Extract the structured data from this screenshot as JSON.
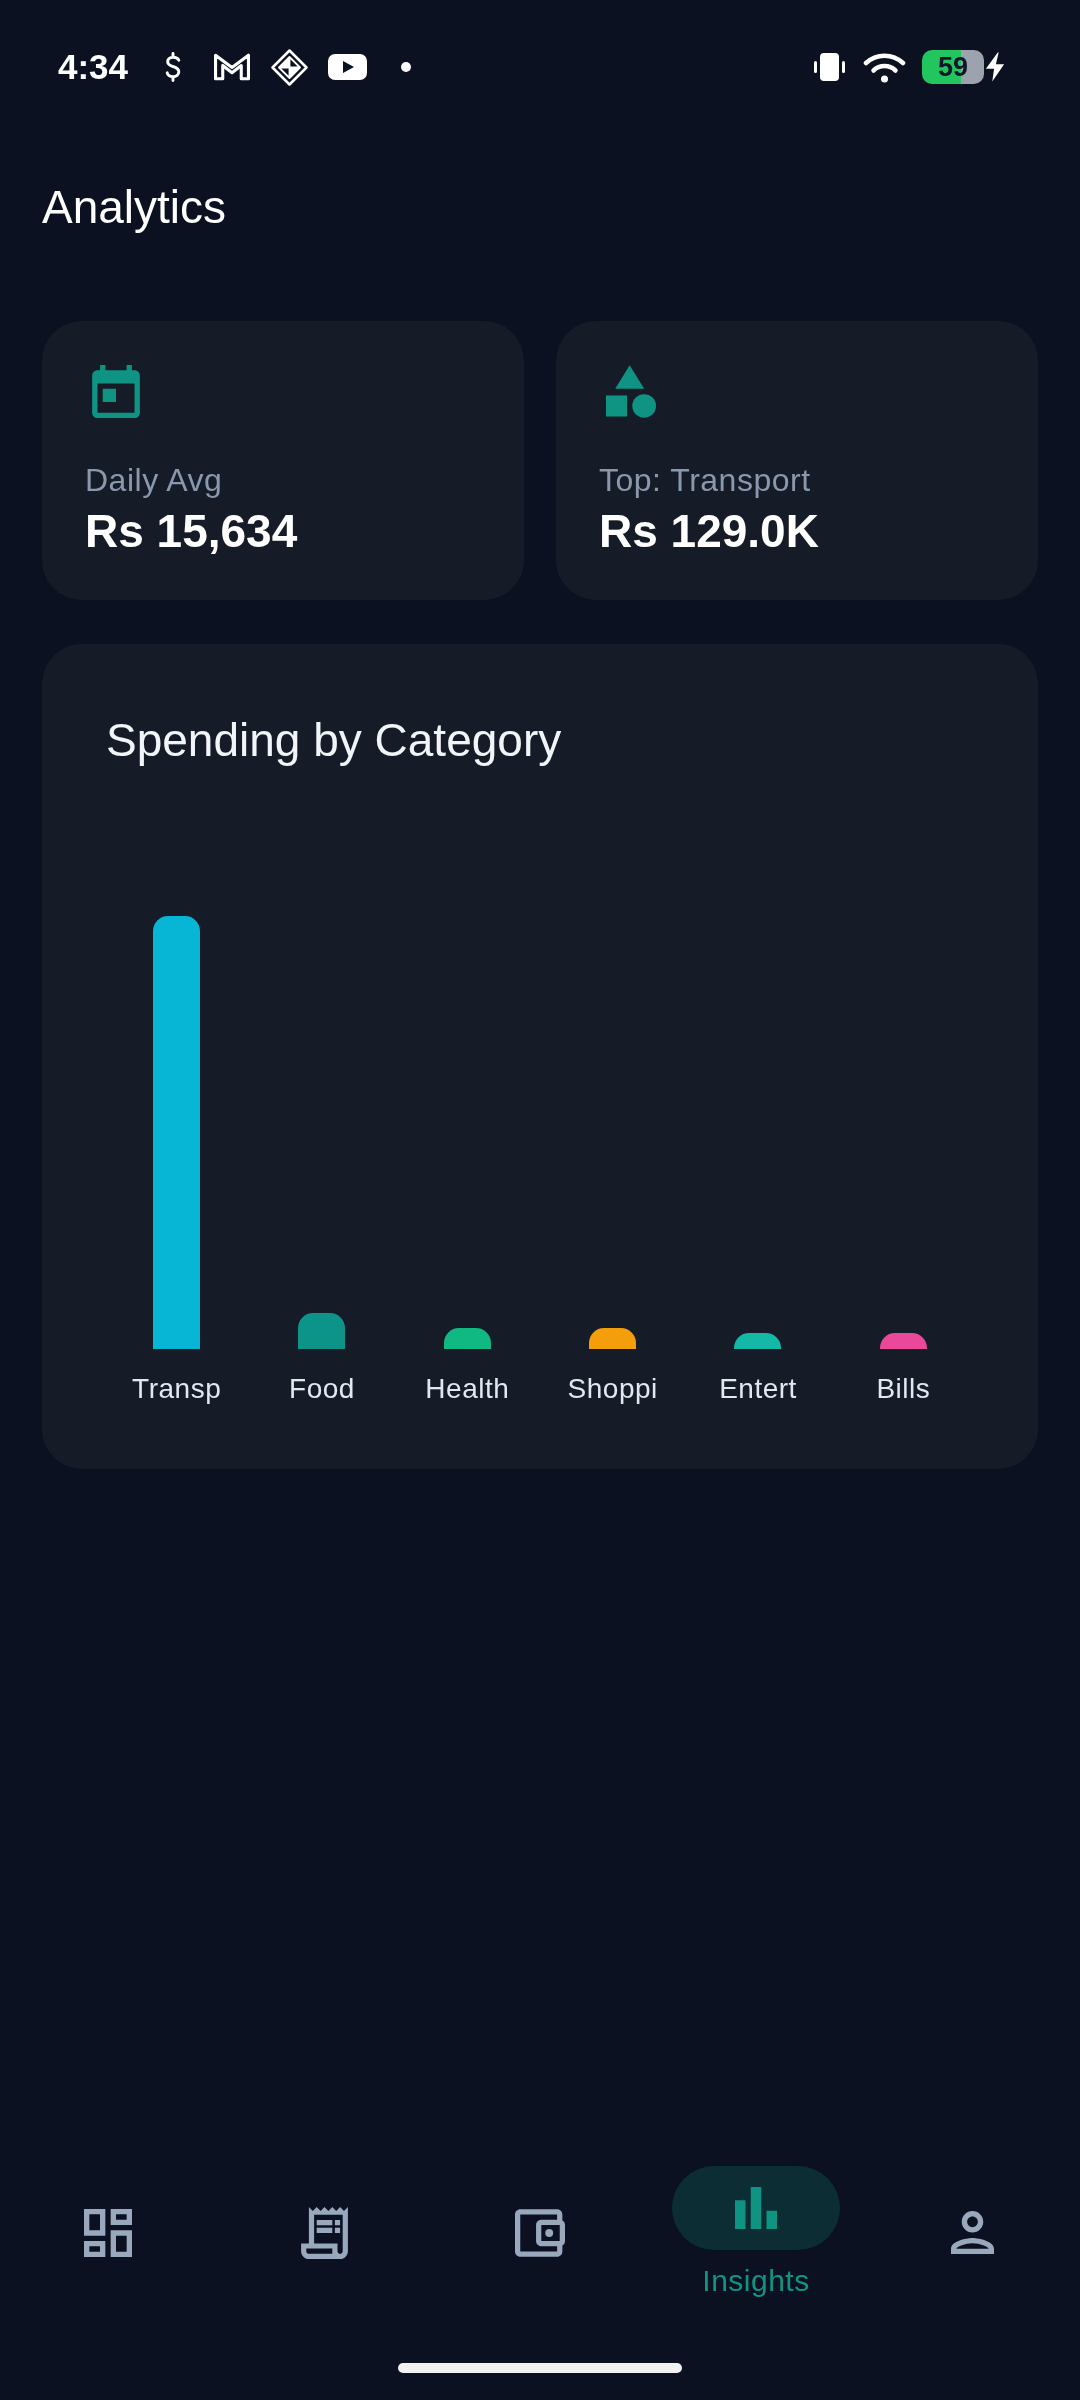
{
  "status_bar": {
    "time": "4:34",
    "battery": "59"
  },
  "header": {
    "title": "Analytics"
  },
  "summary_cards": [
    {
      "label": "Daily Avg",
      "value": "Rs 15,634"
    },
    {
      "label": "Top: Transport",
      "value": "Rs 129.0K"
    }
  ],
  "chart": {
    "title": "Spending by Category",
    "categories": [
      {
        "label": "Transp",
        "color": "#06b6d4"
      },
      {
        "label": "Food",
        "color": "#0d9488"
      },
      {
        "label": "Health",
        "color": "#10b981"
      },
      {
        "label": "Shoppi",
        "color": "#f59e0b"
      },
      {
        "label": "Entert",
        "color": "#14b8a6"
      },
      {
        "label": "Bills",
        "color": "#ec4899"
      }
    ]
  },
  "bottom_nav": [
    {
      "selected": false
    },
    {
      "selected": false
    },
    {
      "selected": false
    },
    {
      "label": "Insights",
      "selected": true
    },
    {
      "selected": false
    }
  ]
}
